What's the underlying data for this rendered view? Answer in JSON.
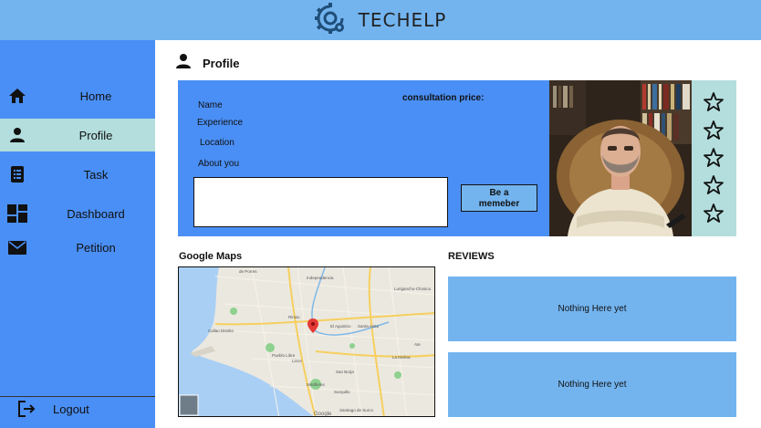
{
  "header": {
    "title": "TECHELP",
    "logo_icon": "gear-logo-icon"
  },
  "sidebar": {
    "items": [
      {
        "label": "Home",
        "icon": "home-icon"
      },
      {
        "label": "Profile",
        "icon": "user-icon",
        "active": true
      },
      {
        "label": "Task",
        "icon": "clipboard-icon"
      },
      {
        "label": "Dashboard",
        "icon": "dashboard-icon"
      },
      {
        "label": "Petition",
        "icon": "mail-icon"
      }
    ],
    "logout": {
      "label": "Logout",
      "icon": "logout-icon"
    }
  },
  "page": {
    "title": "Profile",
    "icon": "user-icon"
  },
  "profile": {
    "fields": [
      "Name",
      "Experience",
      "Location",
      "About you"
    ],
    "price_label": "consultation price:",
    "about_value": "",
    "member_button": "Be a memeber",
    "rating_stars": 5,
    "filled_stars": 0
  },
  "map": {
    "title": "Google Maps",
    "places": [
      "de Porres",
      "Independencia",
      "Lurigancho-Chosica",
      "Rimac",
      "Callao Distrito",
      "El Agustino",
      "Santa Anita",
      "Miraflores",
      "San Borja",
      "Surquillo",
      "Santiago de Surco",
      "La Molina",
      "Pueblo Libre",
      "Lince",
      "Ate"
    ],
    "footer": "Google"
  },
  "reviews": {
    "title": "REVIEWS",
    "items": [
      "Nothing Here yet",
      "Nothing Here yet"
    ]
  },
  "colors": {
    "header": "#73b4ef",
    "sidebar": "#4a8ff5",
    "active": "#b3dedd",
    "card": "#4a8ff5"
  }
}
